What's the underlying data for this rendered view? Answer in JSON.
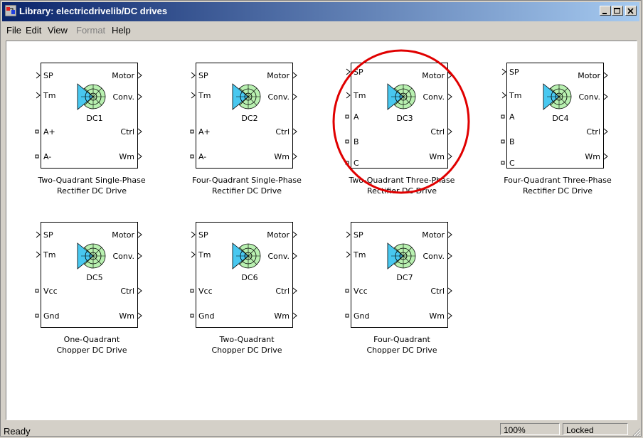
{
  "window": {
    "title": "Library: electricdrivelib/DC drives"
  },
  "menu": {
    "file": "File",
    "edit": "Edit",
    "view": "View",
    "format": "Format",
    "help": "Help"
  },
  "blocks": [
    {
      "name": "DC1",
      "inputs": [
        "SP",
        "Tm",
        "A+",
        "A-"
      ],
      "outputs": [
        "Motor",
        "Conv.",
        "Ctrl",
        "Wm"
      ],
      "caption_line1": "Two-Quadrant Single-Phase",
      "caption_line2": "Rectifier DC Drive"
    },
    {
      "name": "DC2",
      "inputs": [
        "SP",
        "Tm",
        "A+",
        "A-"
      ],
      "outputs": [
        "Motor",
        "Conv.",
        "Ctrl",
        "Wm"
      ],
      "caption_line1": "Four-Quadrant Single-Phase",
      "caption_line2": "Rectifier DC Drive"
    },
    {
      "name": "DC3",
      "inputs": [
        "SP",
        "Tm",
        "A",
        "B",
        "C"
      ],
      "outputs": [
        "Motor",
        "Conv.",
        "Ctrl",
        "Wm"
      ],
      "caption_line1": "Two-Quadrant Three-Phase",
      "caption_line2": "Rectifier DC Drive"
    },
    {
      "name": "DC4",
      "inputs": [
        "SP",
        "Tm",
        "A",
        "B",
        "C"
      ],
      "outputs": [
        "Motor",
        "Conv.",
        "Ctrl",
        "Wm"
      ],
      "caption_line1": "Four-Quadrant Three-Phase",
      "caption_line2": "Rectifier DC Drive"
    },
    {
      "name": "DC5",
      "inputs": [
        "SP",
        "Tm",
        "Vcc",
        "Gnd"
      ],
      "outputs": [
        "Motor",
        "Conv.",
        "Ctrl",
        "Wm"
      ],
      "caption_line1": "One-Quadrant",
      "caption_line2": "Chopper DC Drive"
    },
    {
      "name": "DC6",
      "inputs": [
        "SP",
        "Tm",
        "Vcc",
        "Gnd"
      ],
      "outputs": [
        "Motor",
        "Conv.",
        "Ctrl",
        "Wm"
      ],
      "caption_line1": "Two-Quadrant",
      "caption_line2": "Chopper DC Drive"
    },
    {
      "name": "DC7",
      "inputs": [
        "SP",
        "Tm",
        "Vcc",
        "Gnd"
      ],
      "outputs": [
        "Motor",
        "Conv.",
        "Ctrl",
        "Wm"
      ],
      "caption_line1": "Four-Quadrant",
      "caption_line2": "Chopper DC Drive"
    }
  ],
  "status": {
    "text": "Ready",
    "zoom": "100%",
    "lock": "Locked"
  },
  "colors": {
    "title_start": "#0a246a",
    "title_end": "#a6caf0",
    "highlight_circle": "#e00000",
    "motor_green": "#b8f0b0",
    "motor_blue": "#48c8f0"
  }
}
